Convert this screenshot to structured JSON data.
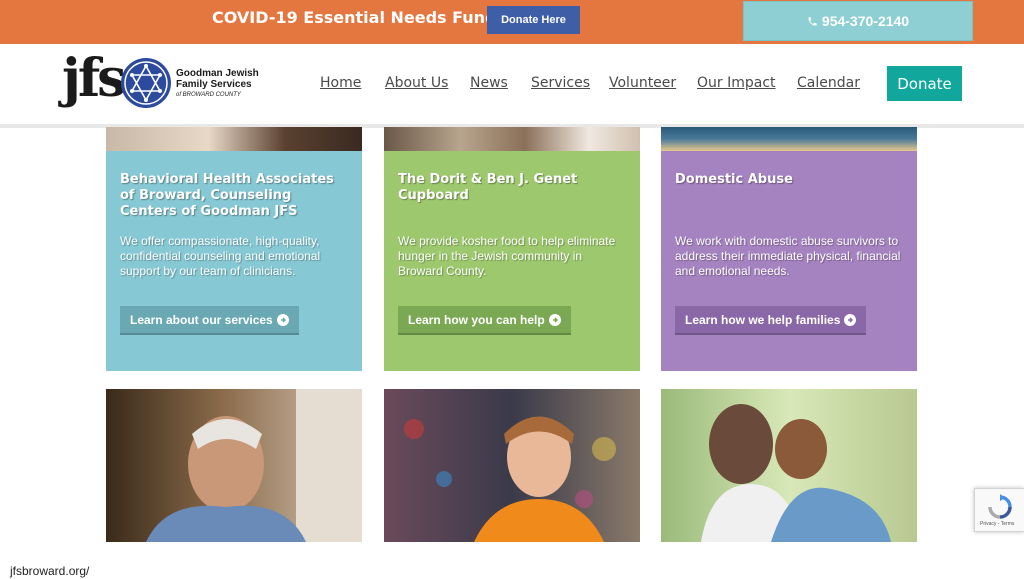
{
  "banner": {
    "title": "COVID-19 Essential Needs Fund",
    "donate_label": "Donate Here",
    "phone": "954-370-2140",
    "phone_icon": "phone-icon"
  },
  "header": {
    "logo": {
      "mark": "jfs",
      "name_line1": "Goodman Jewish",
      "name_line2": "Family Services",
      "name_line3": "of BROWARD COUNTY"
    },
    "nav": [
      "Home",
      "About Us",
      "News",
      "Services",
      "Volunteer",
      "Our Impact",
      "Calendar"
    ],
    "donate_label": "Donate"
  },
  "cards": [
    {
      "title": "Behavioral Health Associates of Broward, Counseling Centers of Goodman JFS",
      "text": "We offer compassionate, high-quality, confidential counseling and emotional support by our team of clinicians.",
      "button": "Learn about our services",
      "color": "#86c8d4",
      "button_color": "#6aa9b3"
    },
    {
      "title": "The Dorit & Ben J. Genet Cupboard",
      "text": "We provide kosher food to help eliminate hunger in the Jewish community in Broward County.",
      "button": "Learn how you can help",
      "color": "#9dc86e",
      "button_color": "#7aa853"
    },
    {
      "title": "Domestic Abuse",
      "text": "We work with domestic abuse survivors to address their immediate physical, financial and emotional needs.",
      "button": "Learn how we help families",
      "color": "#a582c0",
      "button_color": "#8a67a6"
    }
  ],
  "recaptcha": {
    "terms": "Privacy - Terms"
  },
  "status_url": "jfsbroward.org/"
}
